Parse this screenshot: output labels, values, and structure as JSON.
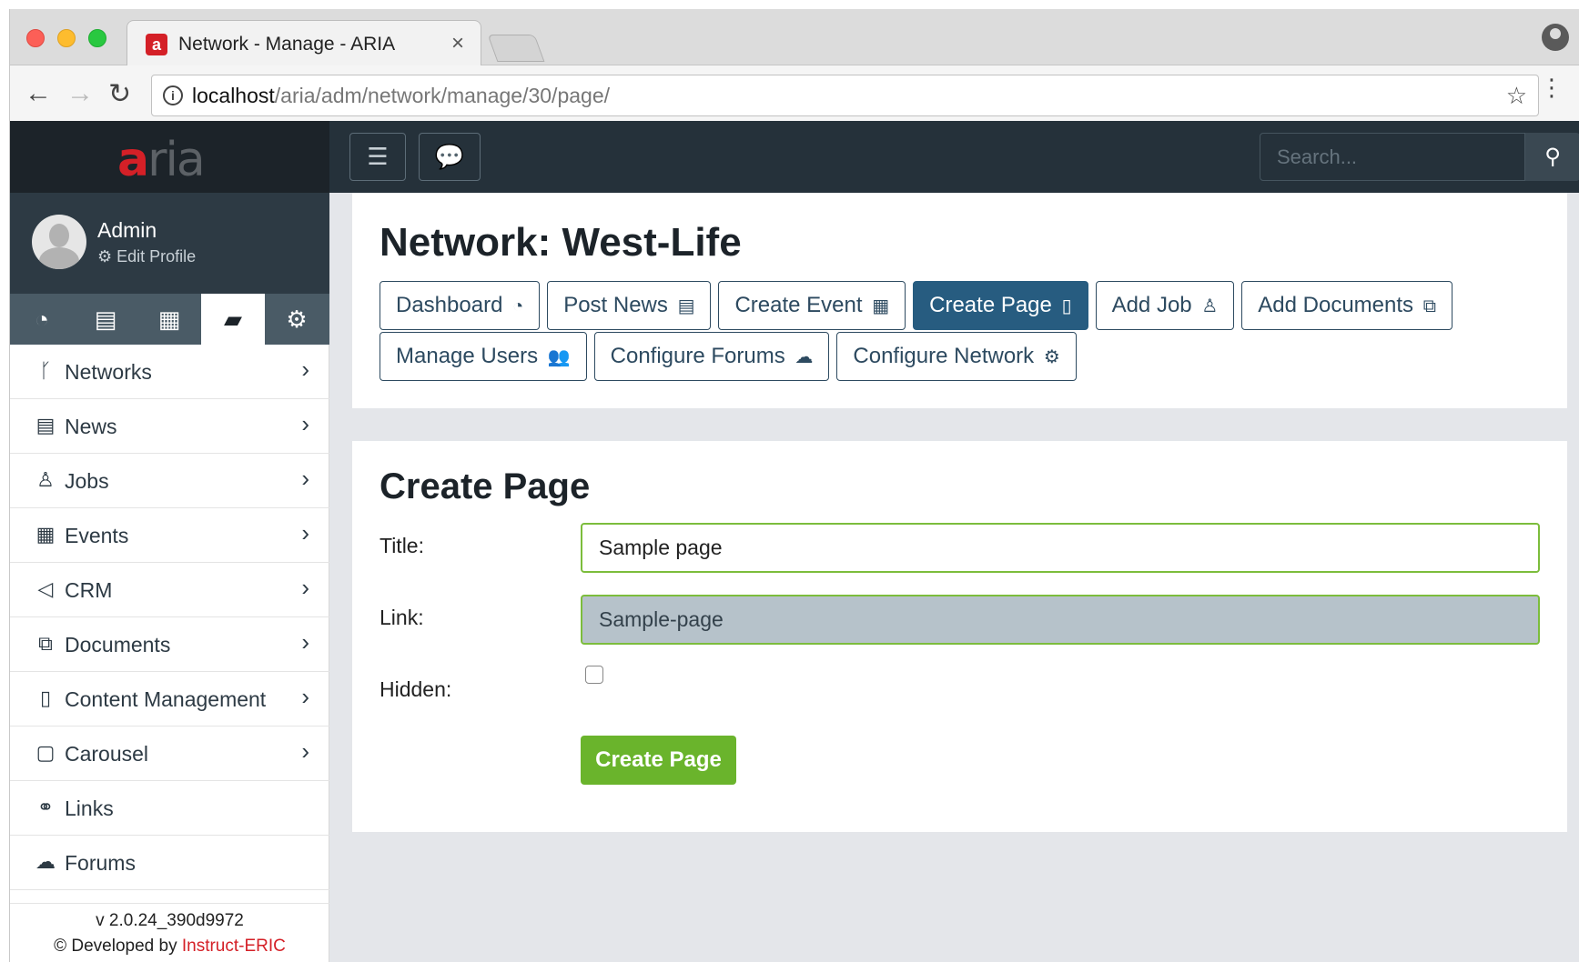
{
  "browser": {
    "tab_title": "Network - Manage - ARIA",
    "tab_favicon": "aria-favicon",
    "tab_close": "×",
    "url_host": "localhost",
    "url_path": "/aria/adm/network/manage/30/page/",
    "icons": {
      "back": "←",
      "forward": "→",
      "reload": "↻",
      "info": "i",
      "star": "☆",
      "menu": "⋮"
    }
  },
  "brand": {
    "logo_a": "a",
    "logo_rest": "ria"
  },
  "user": {
    "name": "Admin",
    "edit_profile": "⚙ Edit Profile"
  },
  "sidebar_tabs": [
    {
      "icon": "dashboard-icon",
      "glyph": "◔"
    },
    {
      "icon": "archive-icon",
      "glyph": "▤"
    },
    {
      "icon": "building-icon",
      "glyph": "▦"
    },
    {
      "icon": "book-icon",
      "glyph": "▰"
    },
    {
      "icon": "gear-icon",
      "glyph": "⚙"
    }
  ],
  "menu": [
    {
      "label": "Networks",
      "glyph": "ᚴ",
      "icon": "code-fork-icon",
      "chevron": true
    },
    {
      "label": "News",
      "glyph": "▤",
      "icon": "file-text-icon",
      "chevron": true
    },
    {
      "label": "Jobs",
      "glyph": "♙",
      "icon": "user-tie-icon",
      "chevron": true
    },
    {
      "label": "Events",
      "glyph": "▦",
      "icon": "calendar-icon",
      "chevron": true
    },
    {
      "label": "CRM",
      "glyph": "◁",
      "icon": "paper-plane-icon",
      "chevron": true
    },
    {
      "label": "Documents",
      "glyph": "⧉",
      "icon": "copy-icon",
      "chevron": true
    },
    {
      "label": "Content Management",
      "glyph": "▯",
      "icon": "file-icon",
      "chevron": true
    },
    {
      "label": "Carousel",
      "glyph": "▢",
      "icon": "square-icon",
      "chevron": true
    },
    {
      "label": "Links",
      "glyph": "⚭",
      "icon": "link-icon",
      "chevron": false
    },
    {
      "label": "Forums",
      "glyph": "☁",
      "icon": "comments-icon",
      "chevron": false
    }
  ],
  "menu_chevron": "›",
  "footer": {
    "version": "v 2.0.24_390d9972",
    "developed_prefix": "© Developed by ",
    "developed_link": "Instruct-ERIC"
  },
  "topnav": {
    "hamburger": "☰",
    "chat": "💬",
    "search_placeholder": "Search...",
    "search_icon": "⚲"
  },
  "network": {
    "title": "Network: West-Life",
    "buttons_row1": [
      {
        "label": "Dashboard",
        "glyph": "◔",
        "icon": "dashboard-icon",
        "active": false
      },
      {
        "label": "Post News",
        "glyph": "▤",
        "icon": "file-text-icon",
        "active": false
      },
      {
        "label": "Create Event",
        "glyph": "▦",
        "icon": "calendar-icon",
        "active": false
      },
      {
        "label": "Create Page",
        "glyph": "▯",
        "icon": "file-icon",
        "active": true
      },
      {
        "label": "Add Job",
        "glyph": "♙",
        "icon": "user-tie-icon",
        "active": false
      },
      {
        "label": "Add Documents",
        "glyph": "⧉",
        "icon": "copy-icon",
        "active": false
      }
    ],
    "buttons_row2": [
      {
        "label": "Manage Users",
        "glyph": "👥",
        "icon": "users-icon",
        "active": false
      },
      {
        "label": "Configure Forums",
        "glyph": "☁",
        "icon": "comments-icon",
        "active": false
      },
      {
        "label": "Configure Network",
        "glyph": "⚙",
        "icon": "cogs-icon",
        "active": false
      }
    ]
  },
  "form": {
    "heading": "Create Page",
    "title_label": "Title:",
    "title_value": "Sample page",
    "link_label": "Link:",
    "link_value": "Sample-page",
    "hidden_label": "Hidden:",
    "hidden_checked": false,
    "submit_label": "Create Page"
  },
  "colors": {
    "brand_red": "#d42027",
    "active_button": "#275c80",
    "submit_green": "#6ab42c",
    "input_border_valid": "#7cbd3c"
  }
}
